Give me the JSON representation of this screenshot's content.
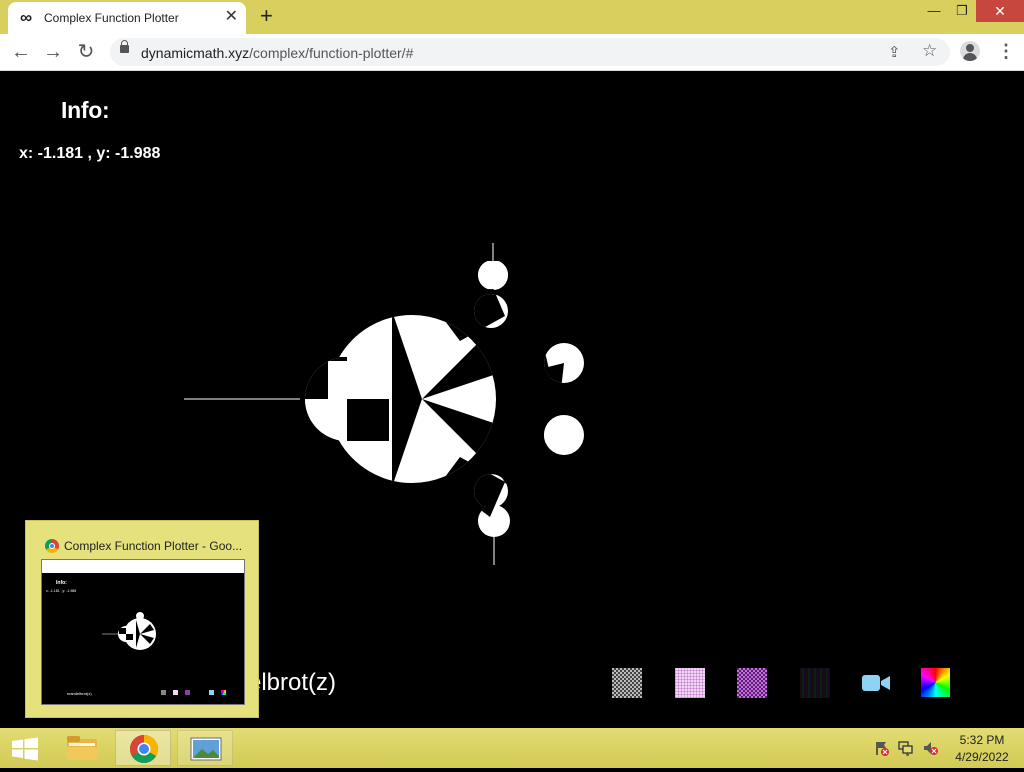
{
  "browser": {
    "tab_title": "Complex Function Plotter",
    "tab_icon": "infinity-icon",
    "new_tab_glyph": "+",
    "tab_close_glyph": "✕",
    "url_host": "dynamicmath.xyz",
    "url_path": "/complex/function-plotter/#",
    "window_controls": {
      "minimize": "—",
      "restore": "❐",
      "close": "✕"
    }
  },
  "page": {
    "info_title": "Info:",
    "coords": "x: -1.181 , y: -1.988",
    "function_label": "elbrot(z)",
    "background": "#000000",
    "swatches": [
      {
        "name": "gray-checker-swatch"
      },
      {
        "name": "pink-grid-swatch"
      },
      {
        "name": "purple-checker-swatch"
      },
      {
        "name": "dark-stripe-swatch"
      },
      {
        "name": "camera-icon",
        "color": "#8fd3f4"
      },
      {
        "name": "color-wheel-swatch"
      }
    ]
  },
  "preview": {
    "title": "Complex Function Plotter - Goo...",
    "mini_info": "Info:",
    "mini_coords": "x: -1.181 , y: -1.988",
    "mini_label": "mandelbrot(z)",
    "background": "#e5e27e"
  },
  "taskbar": {
    "items": [
      "start-button",
      "file-explorer",
      "google-chrome",
      "photos"
    ],
    "clock_time": "5:32 PM",
    "clock_date": "4/29/2022",
    "accent": "#d8cf5e"
  }
}
